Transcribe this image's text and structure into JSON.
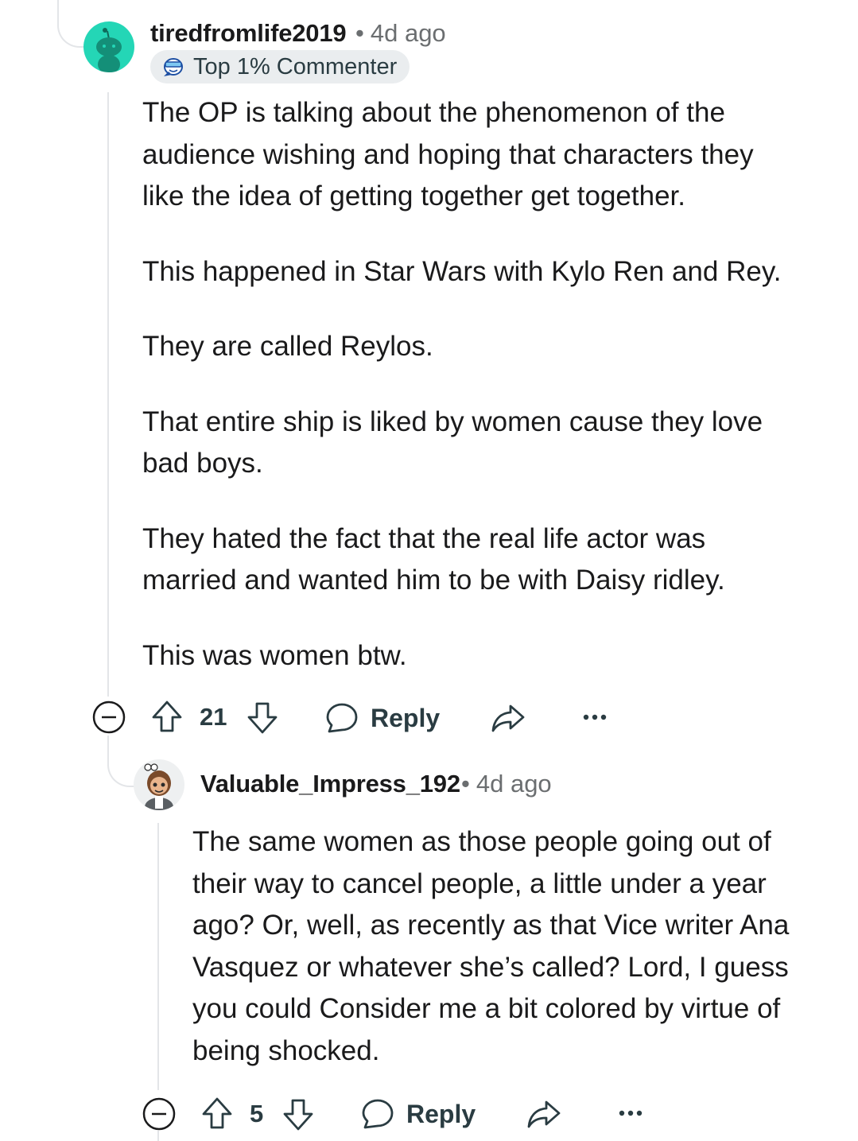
{
  "comments": [
    {
      "username": "tiredfromlife2019",
      "age": "4d ago",
      "flair": "Top 1% Commenter",
      "avatar_icon": "snoo-avatar-icon",
      "paragraphs": [
        "The OP is talking about the phenomenon of the audience wishing and hoping that characters they like the idea of getting together get together.",
        "This happened in Star Wars with Kylo Ren and Rey.",
        "They are called Reylos.",
        "That entire ship is liked by women cause they love bad boys.",
        "They hated the fact that the real life actor was married and wanted him to be with Daisy ridley.",
        "This was women btw."
      ],
      "votes": "21",
      "reply_label": "Reply"
    },
    {
      "username": "Valuable_Impress_192",
      "age": "4d ago",
      "avatar_icon": "custom-avatar-icon",
      "paragraphs": [
        "The same women as those people going out of their way to cancel people, a little under a year ago? Or, well, as recently as that Vice writer Ana Vasquez or whatever she’s called? Lord, I guess you could Consider me a bit colored by virtue of being shocked."
      ],
      "votes": "5",
      "reply_label": "Reply"
    }
  ],
  "colors": {
    "thread_line": "#e3e5e8",
    "avatar_teal": "#24d6b6",
    "meta_gray": "#6b6e70",
    "icon": "#2a3c42"
  }
}
